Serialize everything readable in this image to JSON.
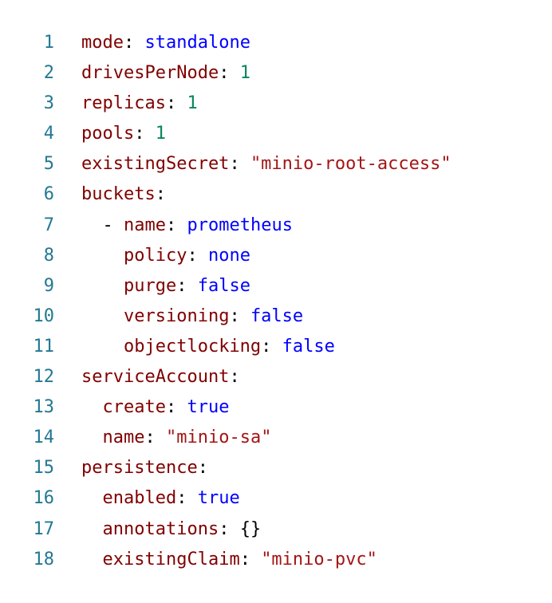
{
  "editor": {
    "colors": {
      "line_number": "#237893",
      "key": "#800000",
      "punctuation": "#000000",
      "number": "#098658",
      "string": "#a31515",
      "keyword": "#0000ff",
      "background": "#ffffff"
    },
    "lines": [
      {
        "n": "1",
        "indent": "",
        "dash": "",
        "key": "mode",
        "sep": ": ",
        "value": "standalone",
        "vtype": "kw"
      },
      {
        "n": "2",
        "indent": "",
        "dash": "",
        "key": "drivesPerNode",
        "sep": ": ",
        "value": "1",
        "vtype": "num"
      },
      {
        "n": "3",
        "indent": "",
        "dash": "",
        "key": "replicas",
        "sep": ": ",
        "value": "1",
        "vtype": "num"
      },
      {
        "n": "4",
        "indent": "",
        "dash": "",
        "key": "pools",
        "sep": ": ",
        "value": "1",
        "vtype": "num"
      },
      {
        "n": "5",
        "indent": "",
        "dash": "",
        "key": "existingSecret",
        "sep": ": ",
        "value": "\"minio-root-access\"",
        "vtype": "str"
      },
      {
        "n": "6",
        "indent": "",
        "dash": "",
        "key": "buckets",
        "sep": ":",
        "value": "",
        "vtype": "plain"
      },
      {
        "n": "7",
        "indent": "  ",
        "dash": "- ",
        "key": "name",
        "sep": ": ",
        "value": "prometheus",
        "vtype": "kw"
      },
      {
        "n": "8",
        "indent": "    ",
        "dash": "",
        "key": "policy",
        "sep": ": ",
        "value": "none",
        "vtype": "kw"
      },
      {
        "n": "9",
        "indent": "    ",
        "dash": "",
        "key": "purge",
        "sep": ": ",
        "value": "false",
        "vtype": "kw"
      },
      {
        "n": "10",
        "indent": "    ",
        "dash": "",
        "key": "versioning",
        "sep": ": ",
        "value": "false",
        "vtype": "kw"
      },
      {
        "n": "11",
        "indent": "    ",
        "dash": "",
        "key": "objectlocking",
        "sep": ": ",
        "value": "false",
        "vtype": "kw"
      },
      {
        "n": "12",
        "indent": "",
        "dash": "",
        "key": "serviceAccount",
        "sep": ":",
        "value": "",
        "vtype": "plain"
      },
      {
        "n": "13",
        "indent": "  ",
        "dash": "",
        "key": "create",
        "sep": ": ",
        "value": "true",
        "vtype": "kw"
      },
      {
        "n": "14",
        "indent": "  ",
        "dash": "",
        "key": "name",
        "sep": ": ",
        "value": "\"minio-sa\"",
        "vtype": "str"
      },
      {
        "n": "15",
        "indent": "",
        "dash": "",
        "key": "persistence",
        "sep": ":",
        "value": "",
        "vtype": "plain"
      },
      {
        "n": "16",
        "indent": "  ",
        "dash": "",
        "key": "enabled",
        "sep": ": ",
        "value": "true",
        "vtype": "kw"
      },
      {
        "n": "17",
        "indent": "  ",
        "dash": "",
        "key": "annotations",
        "sep": ": ",
        "value": "{}",
        "vtype": "plain"
      },
      {
        "n": "18",
        "indent": "  ",
        "dash": "",
        "key": "existingClaim",
        "sep": ": ",
        "value": "\"minio-pvc\"",
        "vtype": "str"
      }
    ]
  }
}
